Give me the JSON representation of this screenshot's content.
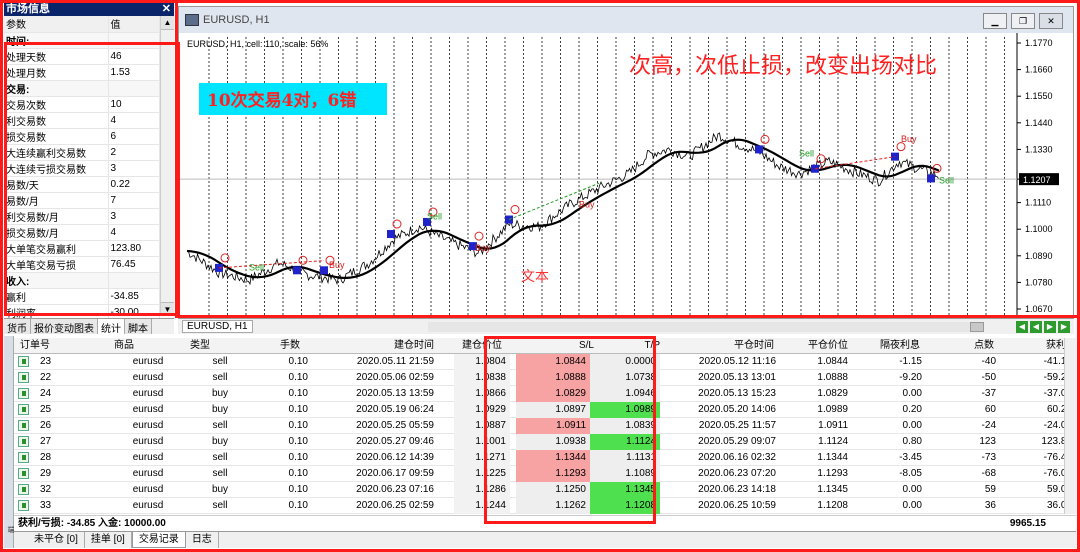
{
  "market_watch": {
    "title": "市场信息",
    "header": {
      "param": "参数",
      "value": "值"
    },
    "rows": [
      {
        "label": "时间:",
        "value": "",
        "section": true
      },
      {
        "label": "处理天数",
        "value": "46"
      },
      {
        "label": "处理月数",
        "value": "1.53"
      },
      {
        "label": "交易:",
        "value": "",
        "section": true
      },
      {
        "label": "交易次数",
        "value": "10"
      },
      {
        "label": "利交易数",
        "value": "4"
      },
      {
        "label": "损交易数",
        "value": "6"
      },
      {
        "label": "大连续赢利交易数",
        "value": "2"
      },
      {
        "label": "大连续亏损交易数",
        "value": "3"
      },
      {
        "label": "易数/天",
        "value": "0.22"
      },
      {
        "label": "易数/月",
        "value": "7"
      },
      {
        "label": "利交易数/月",
        "value": "3"
      },
      {
        "label": "损交易数/月",
        "value": "4"
      },
      {
        "label": "大单笔交易赢利",
        "value": "123.80"
      },
      {
        "label": "大单笔交易亏损",
        "value": "76.45"
      },
      {
        "label": "收入:",
        "value": "",
        "section": true
      },
      {
        "label": "赢利",
        "value": "-34.85"
      },
      {
        "label": "利润率",
        "value": "-30.00"
      }
    ],
    "tabs": [
      "货币",
      "报价变动图表",
      "统计",
      "脚本"
    ]
  },
  "chart_window": {
    "title": "EURUSD, H1",
    "info": "EURUSD, H1, cell: 110, scale: 56%",
    "tab": "EURUSD, H1",
    "annotation_top": "次高，次低止损，改变出场对比",
    "annotation_box": "10次交易4对，6错",
    "annotation_text": "文本",
    "current_price": "1.1207",
    "price_ticks": [
      "1.1770",
      "1.1660",
      "1.1550",
      "1.1440",
      "1.1330",
      "1.1207",
      "1.1110",
      "1.1000",
      "1.0890",
      "1.0780",
      "1.0670"
    ],
    "markers": [
      {
        "label": "Sell",
        "kind": "sell"
      },
      {
        "label": "Buy",
        "kind": "buy"
      },
      {
        "label": "Sell",
        "kind": "sell"
      },
      {
        "label": "Buy",
        "kind": "buy"
      },
      {
        "label": "Sell",
        "kind": "sell"
      },
      {
        "label": "Buy",
        "kind": "buy"
      },
      {
        "label": "Sell",
        "kind": "sell"
      },
      {
        "label": "Buy",
        "kind": "buy"
      }
    ],
    "colors": {
      "accent_red": "#ff1a1a",
      "box_bg": "#00e5ff",
      "box_text": "#ff2020",
      "sl_red": "#f7a3a3",
      "tp_green": "#4fe04f"
    }
  },
  "terminal": {
    "columns": [
      "订单号",
      "商品",
      "类型",
      "手数",
      "建仓时间",
      "建仓价位",
      "S/L",
      "T/P",
      "平仓时间",
      "平仓价位",
      "隔夜利息",
      "点数",
      "获利"
    ],
    "rows": [
      {
        "id": "23",
        "symbol": "eurusd",
        "type": "sell",
        "lots": "0.10",
        "open_time": "2020.05.11 21:59",
        "open_price": "1.0804",
        "sl": "1.0844",
        "tp": "0.0000",
        "close_time": "2020.05.12 11:16",
        "close_price": "1.0844",
        "swap": "-1.15",
        "points": "-40",
        "profit": "-41.15",
        "sl_hl": "red",
        "tp_hl": ""
      },
      {
        "id": "22",
        "symbol": "eurusd",
        "type": "sell",
        "lots": "0.10",
        "open_time": "2020.05.06 02:59",
        "open_price": "1.0838",
        "sl": "1.0888",
        "tp": "1.0738",
        "close_time": "2020.05.13 13:01",
        "close_price": "1.0888",
        "swap": "-9.20",
        "points": "-50",
        "profit": "-59.20",
        "sl_hl": "red",
        "tp_hl": ""
      },
      {
        "id": "24",
        "symbol": "eurusd",
        "type": "buy",
        "lots": "0.10",
        "open_time": "2020.05.13 13:59",
        "open_price": "1.0866",
        "sl": "1.0829",
        "tp": "1.0946",
        "close_time": "2020.05.13 15:23",
        "close_price": "1.0829",
        "swap": "0.00",
        "points": "-37",
        "profit": "-37.00",
        "sl_hl": "red",
        "tp_hl": ""
      },
      {
        "id": "25",
        "symbol": "eurusd",
        "type": "buy",
        "lots": "0.10",
        "open_time": "2020.05.19 06:24",
        "open_price": "1.0929",
        "sl": "1.0897",
        "tp": "1.0989",
        "close_time": "2020.05.20 14:06",
        "close_price": "1.0989",
        "swap": "0.20",
        "points": "60",
        "profit": "60.20",
        "sl_hl": "",
        "tp_hl": "green"
      },
      {
        "id": "26",
        "symbol": "eurusd",
        "type": "sell",
        "lots": "0.10",
        "open_time": "2020.05.25 05:59",
        "open_price": "1.0887",
        "sl": "1.0911",
        "tp": "1.0839",
        "close_time": "2020.05.25 11:57",
        "close_price": "1.0911",
        "swap": "0.00",
        "points": "-24",
        "profit": "-24.00",
        "sl_hl": "red",
        "tp_hl": ""
      },
      {
        "id": "27",
        "symbol": "eurusd",
        "type": "buy",
        "lots": "0.10",
        "open_time": "2020.05.27 09:46",
        "open_price": "1.1001",
        "sl": "1.0938",
        "tp": "1.1124",
        "close_time": "2020.05.29 09:07",
        "close_price": "1.1124",
        "swap": "0.80",
        "points": "123",
        "profit": "123.80",
        "sl_hl": "",
        "tp_hl": "green"
      },
      {
        "id": "28",
        "symbol": "eurusd",
        "type": "sell",
        "lots": "0.10",
        "open_time": "2020.06.12 14:39",
        "open_price": "1.1271",
        "sl": "1.1344",
        "tp": "1.1131",
        "close_time": "2020.06.16 02:32",
        "close_price": "1.1344",
        "swap": "-3.45",
        "points": "-73",
        "profit": "-76.45",
        "sl_hl": "red",
        "tp_hl": ""
      },
      {
        "id": "29",
        "symbol": "eurusd",
        "type": "sell",
        "lots": "0.10",
        "open_time": "2020.06.17 09:59",
        "open_price": "1.1225",
        "sl": "1.1293",
        "tp": "1.1089",
        "close_time": "2020.06.23 07:20",
        "close_price": "1.1293",
        "swap": "-8.05",
        "points": "-68",
        "profit": "-76.05",
        "sl_hl": "red",
        "tp_hl": ""
      },
      {
        "id": "32",
        "symbol": "eurusd",
        "type": "buy",
        "lots": "0.10",
        "open_time": "2020.06.23 07:16",
        "open_price": "1.1286",
        "sl": "1.1250",
        "tp": "1.1345",
        "close_time": "2020.06.23 14:18",
        "close_price": "1.1345",
        "swap": "0.00",
        "points": "59",
        "profit": "59.00",
        "sl_hl": "",
        "tp_hl": "green"
      },
      {
        "id": "33",
        "symbol": "eurusd",
        "type": "sell",
        "lots": "0.10",
        "open_time": "2020.06.25 02:59",
        "open_price": "1.1244",
        "sl": "1.1262",
        "tp": "1.1208",
        "close_time": "2020.06.25 10:59",
        "close_price": "1.1208",
        "swap": "0.00",
        "points": "36",
        "profit": "36.00",
        "sl_hl": "",
        "tp_hl": "green"
      }
    ],
    "summary": "获利/亏损: -34.85  入金: 10000.00",
    "summary_profit": "9965.15",
    "tabs": [
      "未平仓 [0]",
      "挂单 [0]",
      "交易记录",
      "日志"
    ],
    "side_label": "交易终端"
  }
}
